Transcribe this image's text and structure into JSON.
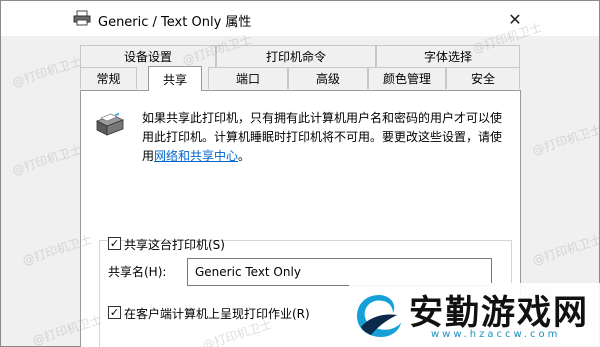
{
  "window": {
    "title": "Generic / Text Only 属性",
    "close_glyph": "✕"
  },
  "tabs": {
    "row1": [
      {
        "label": "设备设置"
      },
      {
        "label": "打印机命令"
      },
      {
        "label": "字体选择"
      }
    ],
    "row2": [
      {
        "label": "常规"
      },
      {
        "label": "共享",
        "selected": true
      },
      {
        "label": "端口"
      },
      {
        "label": "高级"
      },
      {
        "label": "颜色管理"
      },
      {
        "label": "安全"
      }
    ]
  },
  "sharing": {
    "description": "如果共享此打印机，只有拥有此计算机用户名和密码的用户才可以使用此打印机。计算机睡眠时打印机将不可用。要更改这些设置，请使用",
    "link_text": "网络和共享中心",
    "link_suffix": "。",
    "share_checkbox_label": "共享这台打印机(S)",
    "share_checkbox_checked": true,
    "share_name_label": "共享名(H):",
    "share_name_value": "Generic  Text Only",
    "render_checkbox_label": "在客户端计算机上呈现打印作业(R)",
    "render_checkbox_checked": true
  },
  "watermarks": {
    "text": "@打印机卫士"
  },
  "brand": {
    "name": "安勤游戏网",
    "url": "www.hzaccw.com"
  },
  "icons": {
    "title_icon": "printer-icon",
    "content_icon": "printer-icon",
    "close": "close-icon",
    "check": "checkmark-icon"
  }
}
